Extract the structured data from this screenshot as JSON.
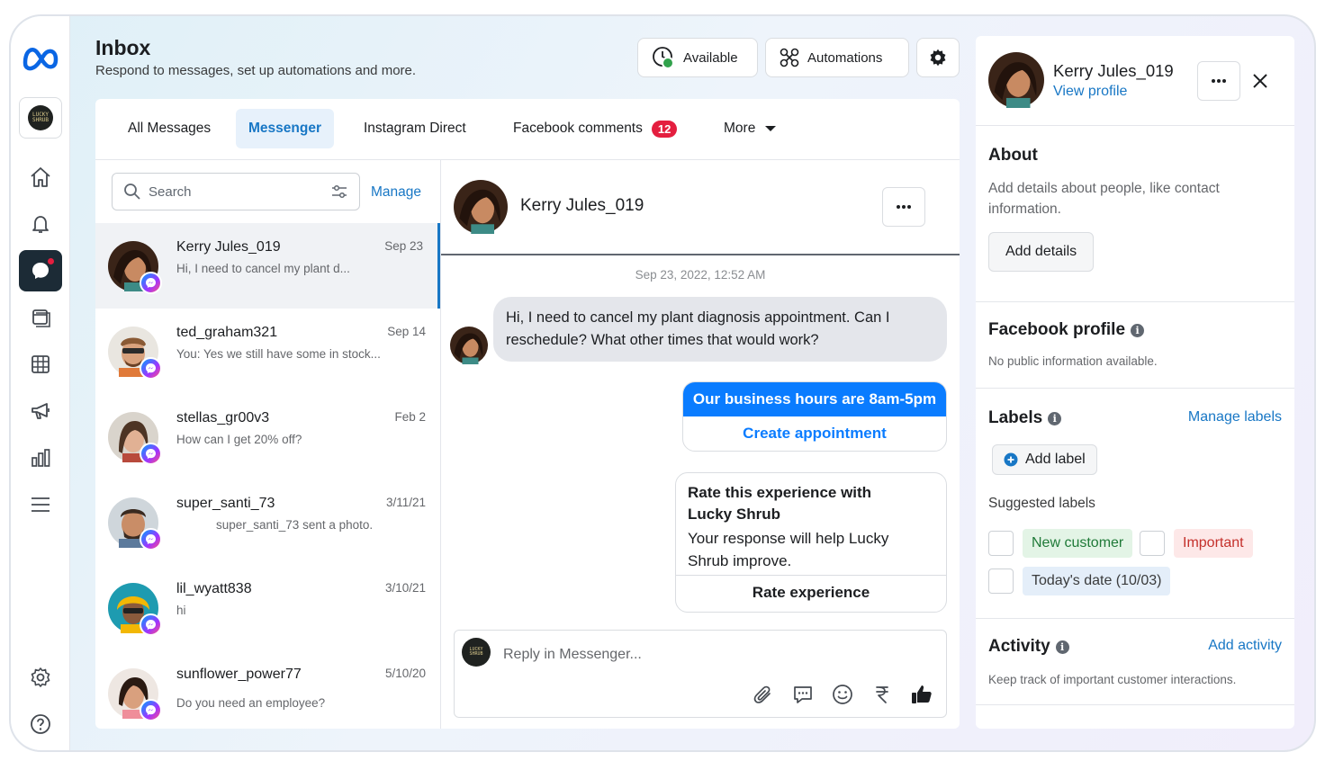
{
  "header": {
    "title": "Inbox",
    "subtitle": "Respond to messages, set up automations and more.",
    "available_label": "Available",
    "automations_label": "Automations"
  },
  "sidebar": {
    "page_avatar_text": "LUCKY SHRUB",
    "items": [
      "home-icon",
      "bell-icon",
      "messenger-icon",
      "posts-icon",
      "table-icon",
      "megaphone-icon",
      "chart-icon",
      "menu-icon",
      "gear-icon",
      "help-icon"
    ]
  },
  "tabs": [
    {
      "label": "All Messages"
    },
    {
      "label": "Messenger"
    },
    {
      "label": "Instagram Direct"
    },
    {
      "label": "Facebook comments",
      "badge": "12"
    },
    {
      "label": "More"
    }
  ],
  "list": {
    "search_placeholder": "Search",
    "manage_label": "Manage",
    "conversations": [
      {
        "name": "Kerry Jules_019",
        "date": "Sep 23",
        "snippet": "Hi, I need to cancel my plant d..."
      },
      {
        "name": "ted_graham321",
        "date": "Sep 14",
        "snippet": "You: Yes we still have some in stock..."
      },
      {
        "name": "stellas_gr00v3",
        "date": "Feb 2",
        "snippet": "How can I get 20% off?"
      },
      {
        "name": "super_santi_73",
        "date": "3/11/21",
        "snippet": "super_santi_73 sent a photo."
      },
      {
        "name": "lil_wyatt838",
        "date": "3/10/21",
        "snippet": "hi"
      },
      {
        "name": "sunflower_power77",
        "date": "5/10/20",
        "snippet": "Do you need an employee?"
      }
    ]
  },
  "chat": {
    "name": "Kerry Jules_019",
    "timestamp": "Sep 23, 2022, 12:52 AM",
    "incoming_line1": "Hi, I need to cancel my plant diagnosis appointment. Can I",
    "incoming_line2": "reschedule? What other times that would work?",
    "hours_title": "Our business hours are 8am-5pm",
    "hours_action": "Create appointment",
    "rate_title_line1": "Rate this experience with",
    "rate_title_line2": "Lucky Shrub",
    "rate_body_line1": "Your response will help Lucky",
    "rate_body_line2": "Shrub improve.",
    "rate_action": "Rate experience",
    "reply_placeholder": "Reply in Messenger..."
  },
  "profile": {
    "name": "Kerry Jules_019",
    "view_profile": "View profile",
    "about_title": "About",
    "about_line1": "Add details about people, like contact",
    "about_line2": "information.",
    "add_details": "Add details",
    "fb_title": "Facebook profile",
    "fb_text": "No public information available.",
    "labels_title": "Labels",
    "manage_labels": "Manage labels",
    "add_label": "Add label",
    "suggested_labels": "Suggested labels",
    "label_new_customer": "New customer",
    "label_important": "Important",
    "label_today": "Today's date (10/03)",
    "activity_title": "Activity",
    "add_activity": "Add activity",
    "activity_text": "Keep track of important customer interactions."
  },
  "colors": {
    "accent": "#1877c5",
    "messenger_blue": "#0a7cff",
    "badge_red": "#e41e3f",
    "status_green": "#31a24c"
  }
}
